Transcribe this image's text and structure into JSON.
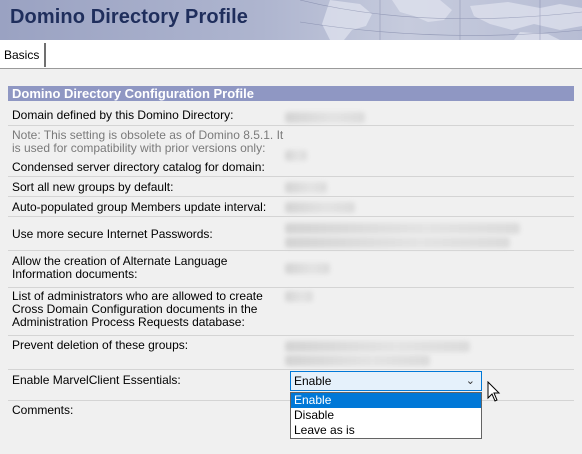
{
  "window": {
    "title": "Domino Directory Profile"
  },
  "tabs": [
    {
      "label": "Basics"
    }
  ],
  "section": {
    "title": "Domino Directory Configuration Profile"
  },
  "fields": [
    {
      "label": "Domain defined by this Domino Directory:"
    },
    {
      "note": "Note: This setting is obsolete as of Domino 8.5.1. It is used for compatibility with prior versions only:",
      "label": "Condensed server directory catalog for domain:"
    },
    {
      "label": "Sort all new groups by default:"
    },
    {
      "label": "Auto-populated group Members update interval:"
    },
    {
      "label": "Use more secure Internet Passwords:"
    },
    {
      "label": "Allow the creation of Alternate Language Information documents:"
    },
    {
      "label": "List of administrators who are allowed to create Cross Domain Configuration documents in the Administration Process Requests database:"
    },
    {
      "label": "Prevent deletion of these groups:"
    },
    {
      "label": "Enable MarvelClient Essentials:",
      "value": "Enable",
      "options": [
        "Enable",
        "Disable",
        "Leave as is"
      ],
      "selected_option": "Enable"
    },
    {
      "label": "Comments:"
    }
  ],
  "colors": {
    "accent": "#0078d7",
    "section_header": "#8f97c3",
    "title_text": "#1f2e5c"
  },
  "icons": {
    "dropdown": "chevron-down-icon",
    "pointer": "mouse-cursor-icon"
  }
}
